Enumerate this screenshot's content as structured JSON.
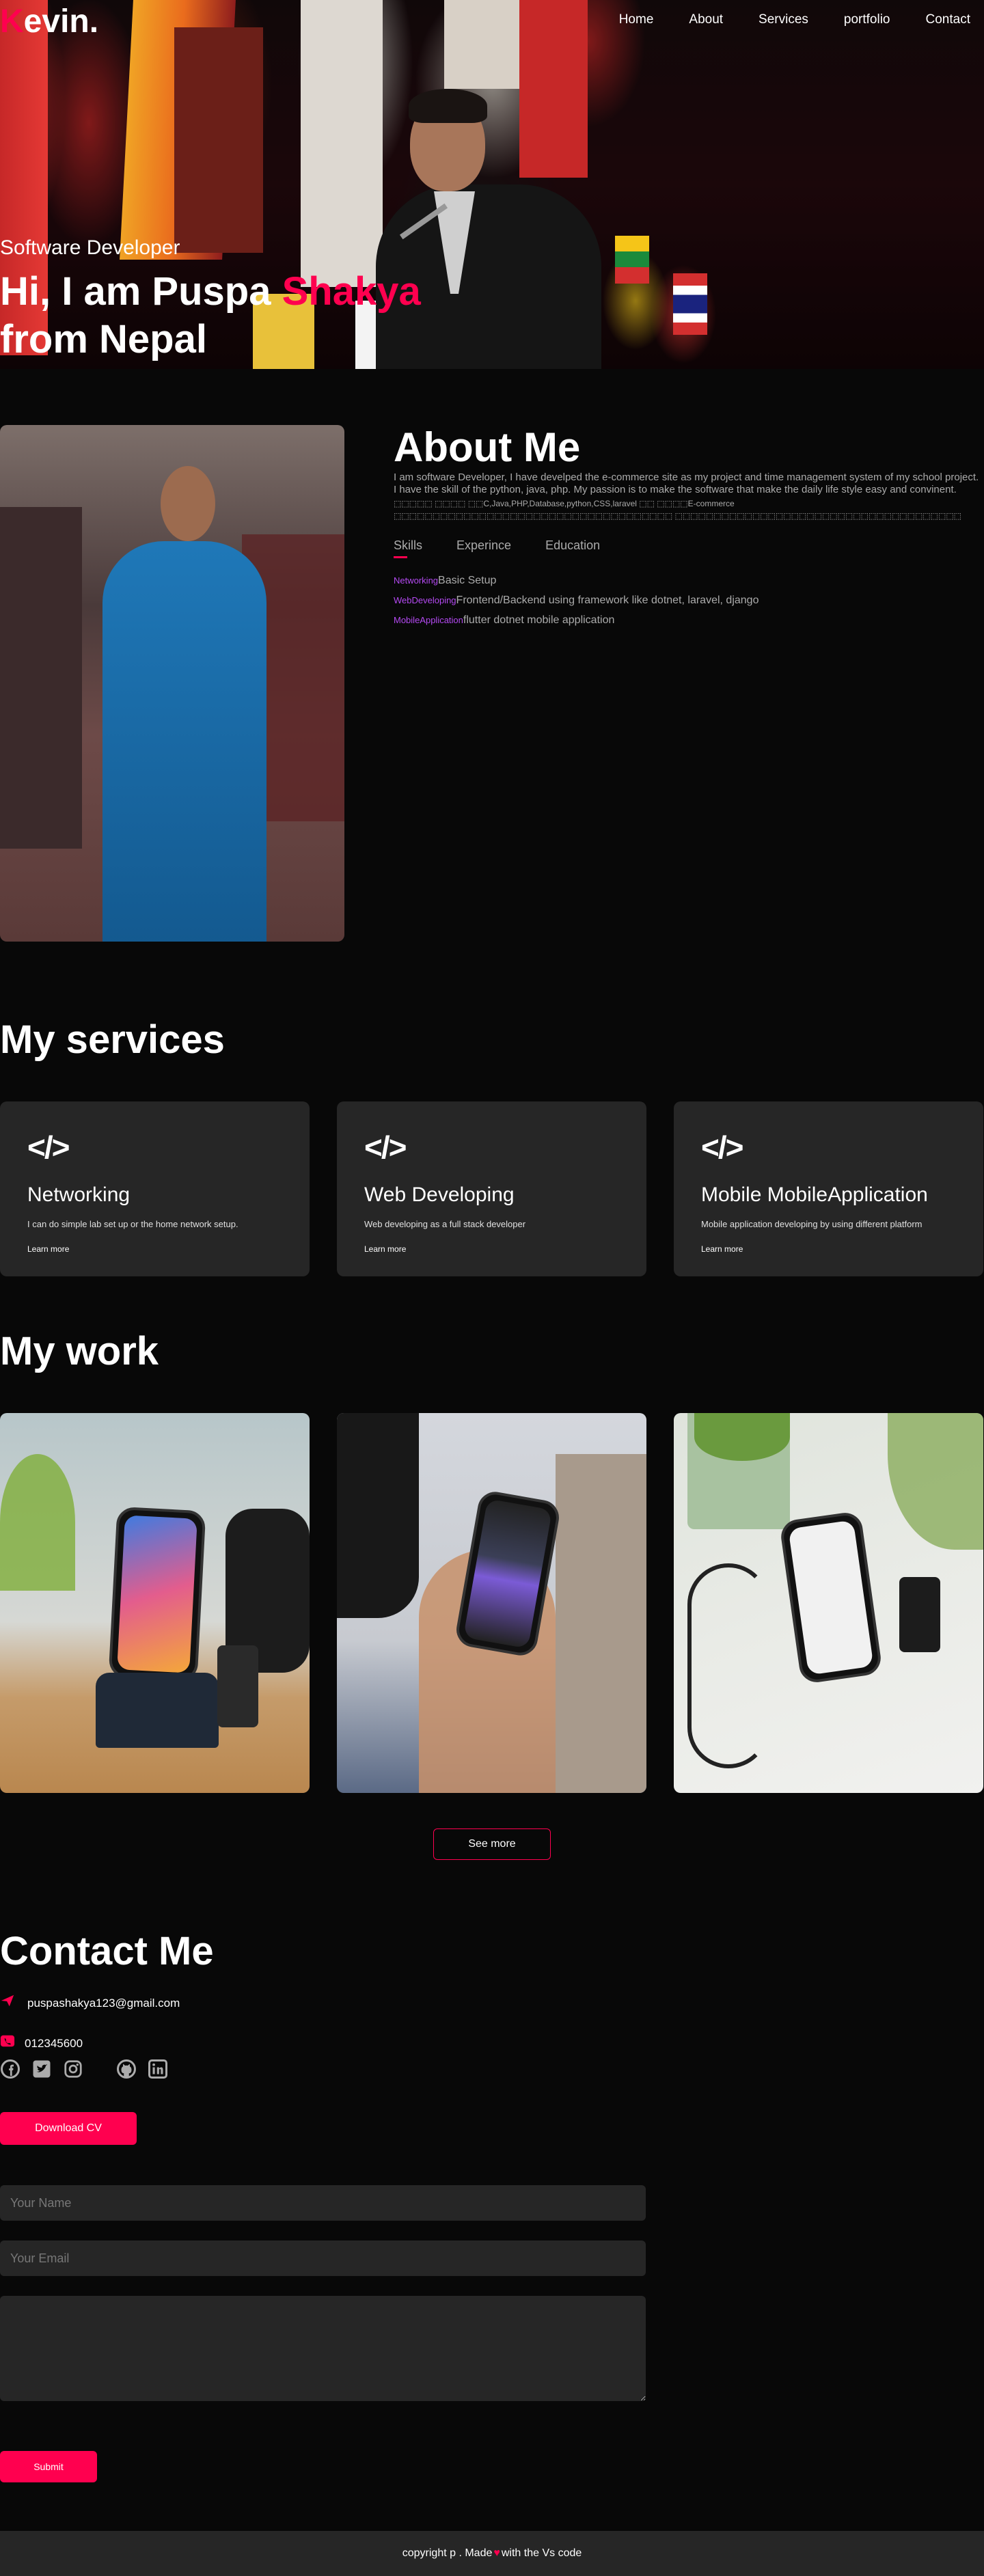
{
  "nav": {
    "logo_first": "K",
    "logo_rest": "evin.",
    "links": [
      "Home",
      "About",
      "Services",
      "portfolio",
      "Contact"
    ]
  },
  "hero": {
    "subtitle": "Software Developer",
    "title_prefix": "Hi, I am Puspa ",
    "title_accent": "Shakya",
    "title_line2": "from Nepal"
  },
  "about": {
    "title": "About Me",
    "description": "I am software Developer, I have develped the e-commerce site as my project and time management system of my school project. I have the skill of the python, java, php. My passion is to make the software that make the daily life style easy and convinent.",
    "description_line2": "⬚⬚⬚⬚⬚ ⬚⬚⬚⬚ ⬚⬚C,Java,PHP,Database,python,CSS,laravel ⬚⬚ ⬚⬚⬚⬚E-commerce ⬚⬚⬚⬚⬚⬚⬚⬚⬚⬚⬚⬚⬚⬚⬚⬚⬚⬚⬚⬚⬚⬚⬚⬚⬚⬚⬚⬚⬚⬚⬚⬚⬚⬚⬚⬚ ⬚⬚⬚⬚⬚⬚⬚⬚⬚⬚⬚⬚⬚⬚⬚⬚⬚⬚⬚⬚⬚⬚⬚⬚⬚⬚⬚⬚⬚⬚⬚⬚⬚⬚⬚⬚⬚",
    "tabs": [
      "Skills",
      "Experince",
      "Education"
    ],
    "skills": [
      {
        "tag": "Networking",
        "text": "Basic Setup"
      },
      {
        "tag": "WebDeveloping",
        "text": "Frontend/Backend using framework like dotnet, laravel, django"
      },
      {
        "tag": "MobileApplication",
        "text": "flutter dotnet mobile application"
      }
    ]
  },
  "services": {
    "title": "My services",
    "items": [
      {
        "icon": "</>",
        "title": "Networking",
        "desc": "I can do simple lab set up or the home network setup.",
        "link": "Learn more"
      },
      {
        "icon": "</>",
        "title": "Web Developing",
        "desc": "Web developing as a full stack developer",
        "link": "Learn more"
      },
      {
        "icon": "</>",
        "title": "Mobile MobileApplication",
        "desc": "Mobile application developing by using different platform",
        "link": "Learn more"
      }
    ]
  },
  "work": {
    "title": "My work",
    "see_more": "See more"
  },
  "contact": {
    "title": "Contact Me",
    "email": "puspashakya123@gmail.com",
    "phone": "012345600",
    "cv_label": "Download CV",
    "name_placeholder": "Your Name",
    "email_placeholder": "Your Email",
    "submit_label": "Submit"
  },
  "footer": {
    "text_before": "copyright p . Made",
    "heart": "♥",
    "text_after": "with the Vs code"
  },
  "colors": {
    "accent": "#ff004f",
    "background": "#080808",
    "card": "#262626",
    "skill_tag": "#b54af3"
  }
}
